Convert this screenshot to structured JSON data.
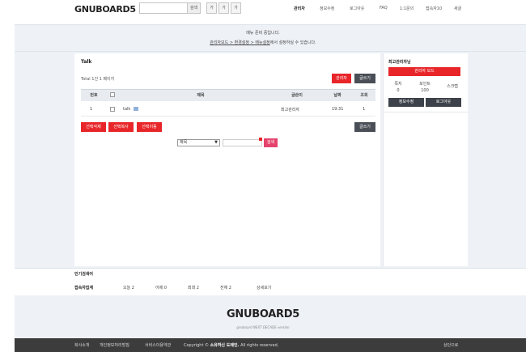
{
  "header": {
    "logo": "GNUBOARD5",
    "search_button": "검색",
    "font_buttons": [
      "가",
      "가",
      "가"
    ],
    "nav": [
      "관리자",
      "정보수정",
      "로그아웃",
      "FAQ",
      "1:1문의",
      "접속자10",
      "새글"
    ]
  },
  "notice": {
    "line1": "메뉴 준비 중입니다.",
    "line2_link": "관리자모드 > 환경설정 > 메뉴설정",
    "line2_rest": "에서 설정하실 수 있습니다."
  },
  "board": {
    "title": "Talk",
    "total": "Total 1건 1 페이지",
    "admin_button": "관리자",
    "write_button": "글쓰기",
    "columns": [
      "번호",
      "제목",
      "글쓴이",
      "날짜",
      "조회"
    ],
    "rows": [
      {
        "num": "1",
        "subject": "talk",
        "author": "최고관리자",
        "date": "19:31",
        "views": "1"
      }
    ],
    "bottom_buttons": [
      "선택삭제",
      "선택복사",
      "선택이동"
    ],
    "write_button_bottom": "글쓰기",
    "search_select": "제목",
    "search_submit": "검색"
  },
  "sidebar": {
    "title": "최고관리자님",
    "admin_mode": "관리자 모드",
    "stats": [
      {
        "label": "쪽지",
        "value": "0"
      },
      {
        "label": "포인트",
        "value": "100"
      },
      {
        "label": "스크랩",
        "value": ""
      }
    ],
    "edit_info": "정보수정",
    "logout": "로그아웃"
  },
  "popular": {
    "label": "인기검색어"
  },
  "visit": {
    "label": "접속자집계",
    "items": [
      "오늘  2",
      "어제  0",
      "최대  2",
      "전체  2"
    ],
    "detail": "상세보기"
  },
  "footer": {
    "logo": "GNUBOARD5",
    "slogan": "gnuboard NEXT DECADE version",
    "links": [
      "회사소개",
      "개인정보처리방침",
      "서비스이용약관"
    ],
    "copyright_prefix": "Copyright ©",
    "copyright_domain": "소유하신 도메인.",
    "copyright_suffix": "All rights reserved.",
    "top": "상단으로"
  },
  "colors": {
    "accent_red": "#e8262a",
    "dark_button": "#4a4f57",
    "search_pink": "#e5436c",
    "footer_bg": "#3c3c3c",
    "page_bg": "#eef1f6"
  }
}
